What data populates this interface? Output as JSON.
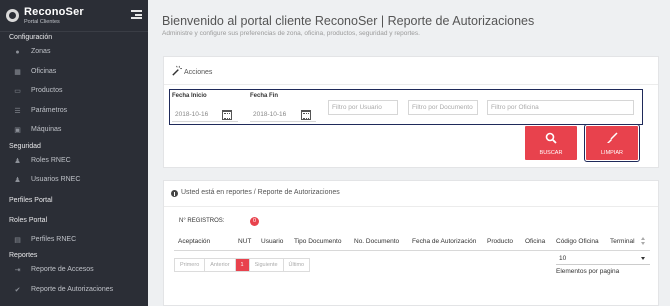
{
  "brand": {
    "name": "ReconoSer",
    "sub": "Portal Clientes"
  },
  "sidebar": {
    "sections": [
      {
        "title": "Configuración",
        "items": [
          {
            "label": "Zonas",
            "icon": "map-marker-icon"
          },
          {
            "label": "Oficinas",
            "icon": "building-icon"
          },
          {
            "label": "Productos",
            "icon": "credit-card-icon"
          },
          {
            "label": "Parámetros",
            "icon": "list-icon"
          },
          {
            "label": "Máquinas",
            "icon": "desktop-icon"
          }
        ]
      },
      {
        "title": "Seguridad",
        "items": [
          {
            "label": "Roles RNEC",
            "icon": "user-icon"
          },
          {
            "label": "Usuarios RNEC",
            "icon": "users-icon"
          }
        ]
      },
      {
        "title": "Perfiles Portal",
        "items": []
      },
      {
        "title": "Roles Portal",
        "items": [
          {
            "label": "Perfiles RNEC",
            "icon": "id-card-icon"
          }
        ]
      },
      {
        "title": "Reportes",
        "items": [
          {
            "label": "Reporte de Accesos",
            "icon": "sign-in-icon"
          },
          {
            "label": "Reporte de Autorizaciones",
            "icon": "check-icon"
          }
        ]
      }
    ]
  },
  "header": {
    "title": "Bienvenido al portal cliente ReconoSer | Reporte de Autorizaciones",
    "subtitle": "Administre y configure sus preferencias de zona, oficina, productos, seguridad y reportes."
  },
  "acciones": {
    "label": "Acciones",
    "fecha_inicio_label": "Fecha Inicio",
    "fecha_inicio": "2018-10-16",
    "fecha_fin_label": "Fecha Fin",
    "fecha_fin": "2018-10-16",
    "filtro_usuario": "Filtro por Usuario",
    "filtro_documento": "Filtro por Documento",
    "filtro_oficina": "Filtro por Oficina",
    "buscar": "BUSCAR",
    "limpiar": "LIMPIAR"
  },
  "report": {
    "breadcrumb": "Usted está en reportes / Reporte de Autorizaciones",
    "registros_label": "N° REGISTROS:",
    "registros_count": "0",
    "columns": [
      "Aceptación",
      "NUT",
      "Usuario",
      "Tipo Documento",
      "No. Documento",
      "Fecha de Autorización",
      "Producto",
      "Oficina",
      "Código Oficina",
      "Terminal"
    ],
    "pager": [
      "Primero",
      "Anterior",
      "1",
      "Siguiente",
      "Último"
    ],
    "page_size": "10",
    "page_size_label": "Elementos por pagina"
  },
  "colors": {
    "accent": "#e8424d",
    "sidebar": "#2b2e36",
    "highlight_border": "#1f2a5a"
  }
}
